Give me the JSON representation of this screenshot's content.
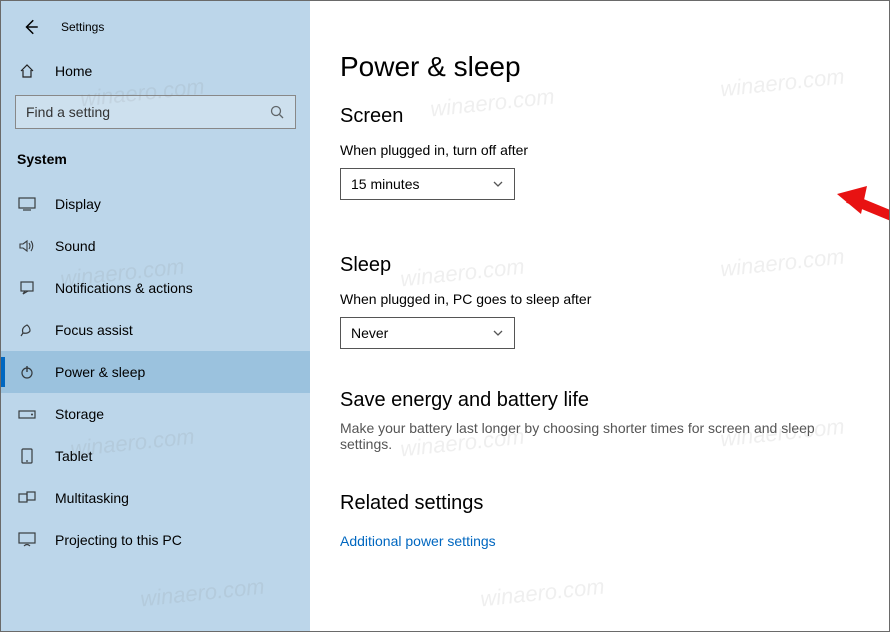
{
  "app_title": "Settings",
  "home_label": "Home",
  "search": {
    "placeholder": "Find a setting"
  },
  "section_label": "System",
  "sidebar": {
    "items": [
      {
        "label": "Display"
      },
      {
        "label": "Sound"
      },
      {
        "label": "Notifications & actions"
      },
      {
        "label": "Focus assist"
      },
      {
        "label": "Power & sleep"
      },
      {
        "label": "Storage"
      },
      {
        "label": "Tablet"
      },
      {
        "label": "Multitasking"
      },
      {
        "label": "Projecting to this PC"
      }
    ]
  },
  "main": {
    "title": "Power & sleep",
    "screen": {
      "heading": "Screen",
      "label": "When plugged in, turn off after",
      "value": "15 minutes"
    },
    "sleep": {
      "heading": "Sleep",
      "label": "When plugged in, PC goes to sleep after",
      "value": "Never"
    },
    "battery": {
      "heading": "Save energy and battery life",
      "text": "Make your battery last longer by choosing shorter times for screen and sleep settings."
    },
    "related": {
      "heading": "Related settings",
      "link": "Additional power settings"
    }
  },
  "watermark": "winaero.com"
}
